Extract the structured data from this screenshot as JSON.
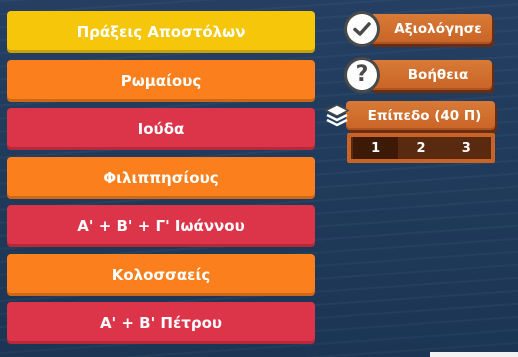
{
  "answers": [
    {
      "label": "Πράξεις Αποστόλων",
      "color": "#f6c60b"
    },
    {
      "label": "Ρωμαίους",
      "color": "#fb7f1d"
    },
    {
      "label": "Ιούδα",
      "color": "#dc3448"
    },
    {
      "label": "Φιλιππησίους",
      "color": "#fb7f1d"
    },
    {
      "label": "Α' + Β' + Γ' Ιωάννου",
      "color": "#dc3448"
    },
    {
      "label": "Κολοσσαείς",
      "color": "#fb7f1d"
    },
    {
      "label": "Α' + Β' Πέτρου",
      "color": "#dc3448"
    }
  ],
  "side_panel": {
    "rate_label": "Αξιολόγησε",
    "rate_icon": "check-icon",
    "help_label": "Βοήθεια",
    "help_icon": "question-icon",
    "help_glyph": "?",
    "level_label": "Επίπεδο (40 Π)",
    "level_icon": "layers-icon",
    "levels": [
      "1",
      "2",
      "3"
    ],
    "active_level": "1"
  },
  "colors": {
    "background": "#1f3a5c",
    "button_orange": "#c86427",
    "yellow": "#f6c60b",
    "orange": "#fb7f1d",
    "red": "#dc3448"
  }
}
